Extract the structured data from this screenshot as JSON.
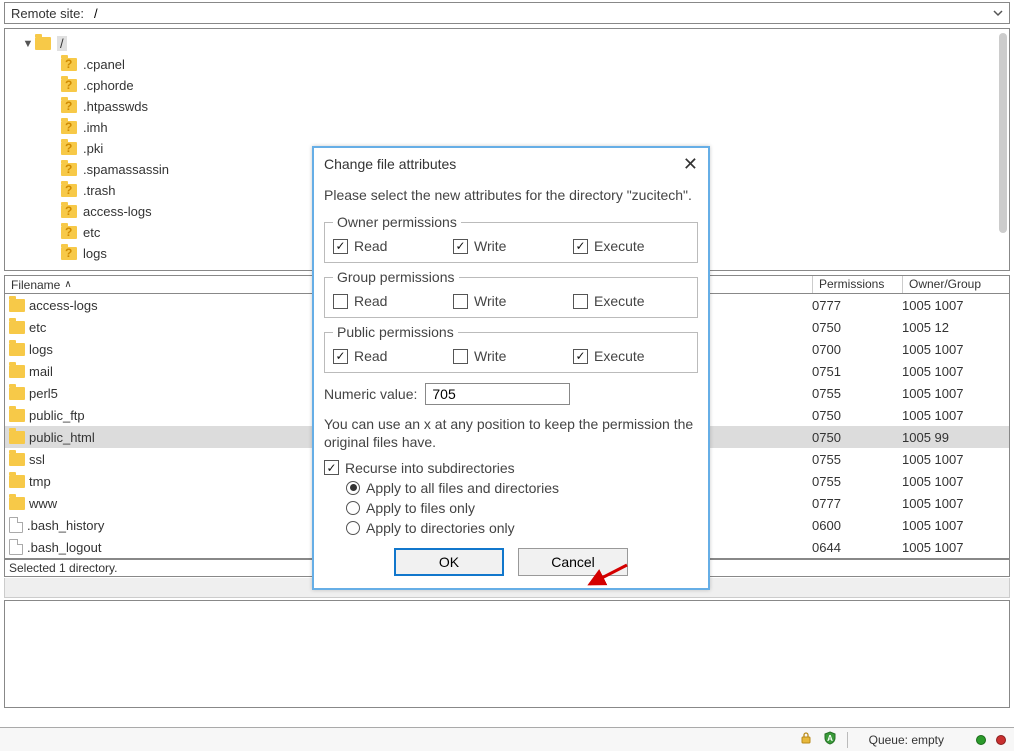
{
  "remote_bar": {
    "label": "Remote site:",
    "path": "/"
  },
  "tree": {
    "root": "/",
    "items": [
      ".cpanel",
      ".cphorde",
      ".htpasswds",
      ".imh",
      ".pki",
      ".spamassassin",
      ".trash",
      "access-logs",
      "etc",
      "logs"
    ]
  },
  "columns": {
    "filename": "Filename",
    "permissions": "Permissions",
    "owner": "Owner/Group"
  },
  "rows": [
    {
      "name": "access-logs",
      "type": "folder",
      "perm": "0777",
      "owner": "1005 1007"
    },
    {
      "name": "etc",
      "type": "folder",
      "perm": "0750",
      "owner": "1005 12"
    },
    {
      "name": "logs",
      "type": "folder",
      "perm": "0700",
      "owner": "1005 1007"
    },
    {
      "name": "mail",
      "type": "folder",
      "perm": "0751",
      "owner": "1005 1007"
    },
    {
      "name": "perl5",
      "type": "folder",
      "perm": "0755",
      "owner": "1005 1007"
    },
    {
      "name": "public_ftp",
      "type": "folder",
      "perm": "0750",
      "owner": "1005 1007"
    },
    {
      "name": "public_html",
      "type": "folder",
      "perm": "0750",
      "owner": "1005 99",
      "selected": true
    },
    {
      "name": "ssl",
      "type": "folder",
      "perm": "0755",
      "owner": "1005 1007"
    },
    {
      "name": "tmp",
      "type": "folder",
      "perm": "0755",
      "owner": "1005 1007"
    },
    {
      "name": "www",
      "type": "folder",
      "perm": "0777",
      "owner": "1005 1007"
    },
    {
      "name": ".bash_history",
      "type": "file",
      "perm": "0600",
      "owner": "1005 1007"
    },
    {
      "name": ".bash_logout",
      "type": "file",
      "perm": "0644",
      "owner": "1005 1007"
    }
  ],
  "status_line": "Selected 1 directory.",
  "dialog": {
    "title": "Change file attributes",
    "intro": "Please select the new attributes for the directory \"zucitech\".",
    "groups": {
      "owner": {
        "legend": "Owner permissions",
        "read": true,
        "write": true,
        "execute": true
      },
      "group": {
        "legend": "Group permissions",
        "read": false,
        "write": false,
        "execute": false
      },
      "public": {
        "legend": "Public permissions",
        "read": true,
        "write": false,
        "execute": true
      }
    },
    "labels": {
      "read": "Read",
      "write": "Write",
      "execute": "Execute"
    },
    "numeric_label": "Numeric value:",
    "numeric_value": "705",
    "hint": "You can use an x at any position to keep the permission the original files have.",
    "recurse_label": "Recurse into subdirectories",
    "recurse_checked": true,
    "radios": {
      "all": "Apply to all files and directories",
      "files": "Apply to files only",
      "dirs": "Apply to directories only",
      "selected": "all"
    },
    "ok": "OK",
    "cancel": "Cancel"
  },
  "statusbar": {
    "queue_label": "Queue: empty"
  }
}
